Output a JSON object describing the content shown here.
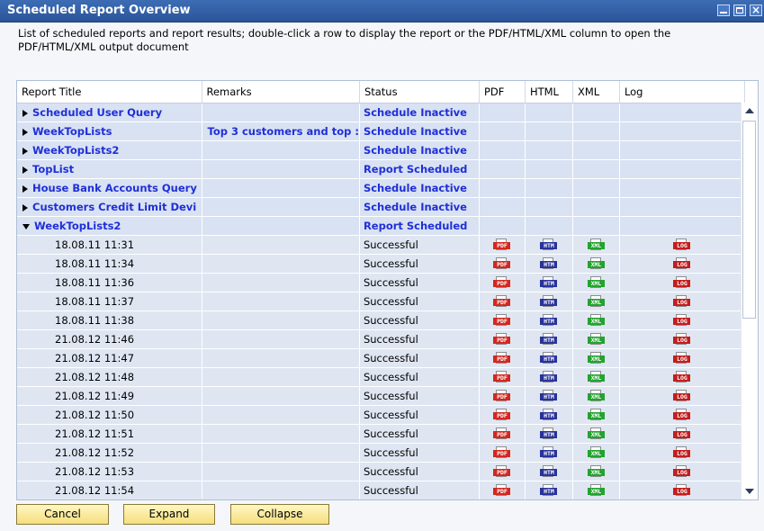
{
  "window": {
    "title": "Scheduled Report Overview"
  },
  "description": "List of scheduled reports and report results; double-click a row to display the report or the PDF/HTML/XML column to open the PDF/HTML/XML output document",
  "columns": [
    "Report Title",
    "Remarks",
    "Status",
    "PDF",
    "HTML",
    "XML",
    "Log"
  ],
  "groups": [
    {
      "title": "Scheduled User Query",
      "remarks": "",
      "status": "Schedule Inactive",
      "expanded": false
    },
    {
      "title": "WeekTopLists",
      "remarks": "Top 3 customers and top :",
      "status": "Schedule Inactive",
      "expanded": false
    },
    {
      "title": "WeekTopLists2",
      "remarks": "",
      "status": "Schedule Inactive",
      "expanded": false
    },
    {
      "title": "TopList",
      "remarks": "",
      "status": "Report Scheduled",
      "expanded": false
    },
    {
      "title": "House Bank Accounts Query",
      "remarks": "",
      "status": "Schedule Inactive",
      "expanded": false
    },
    {
      "title": "Customers Credit Limit Devi",
      "remarks": "",
      "status": "Schedule Inactive",
      "expanded": false
    },
    {
      "title": "WeekTopLists2",
      "remarks": "",
      "status": "Report Scheduled",
      "expanded": true
    }
  ],
  "results": [
    {
      "date": "18.08.11 11:31",
      "status": "Successful"
    },
    {
      "date": "18.08.11 11:34",
      "status": "Successful"
    },
    {
      "date": "18.08.11 11:36",
      "status": "Successful"
    },
    {
      "date": "18.08.11 11:37",
      "status": "Successful"
    },
    {
      "date": "18.08.11 11:38",
      "status": "Successful"
    },
    {
      "date": "21.08.12 11:46",
      "status": "Successful"
    },
    {
      "date": "21.08.12 11:47",
      "status": "Successful"
    },
    {
      "date": "21.08.12 11:48",
      "status": "Successful"
    },
    {
      "date": "21.08.12 11:49",
      "status": "Successful"
    },
    {
      "date": "21.08.12 11:50",
      "status": "Successful"
    },
    {
      "date": "21.08.12 11:51",
      "status": "Successful"
    },
    {
      "date": "21.08.12 11:52",
      "status": "Successful"
    },
    {
      "date": "21.08.12 11:53",
      "status": "Successful"
    },
    {
      "date": "21.08.12 11:54",
      "status": "Successful"
    }
  ],
  "icons": {
    "pdf": "PDF",
    "html": "HTM",
    "xml": "XML",
    "log": "LOG"
  },
  "buttons": {
    "cancel": "Cancel",
    "expand": "Expand",
    "collapse": "Collapse"
  }
}
